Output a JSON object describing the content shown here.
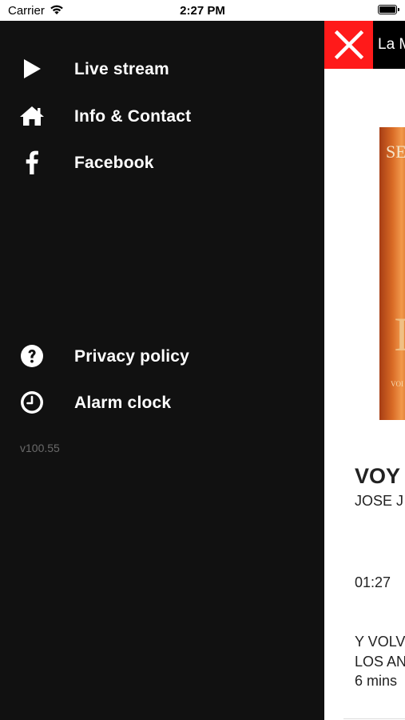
{
  "status_bar": {
    "carrier": "Carrier",
    "time": "2:27 PM"
  },
  "drawer": {
    "background": "#111111",
    "items": [
      {
        "label": "Live stream",
        "icon": "play-icon"
      },
      {
        "label": "Info & Contact",
        "icon": "home-icon"
      },
      {
        "label": "Facebook",
        "icon": "facebook-icon"
      },
      {
        "label": "Privacy policy",
        "icon": "question-circle-icon"
      },
      {
        "label": "Alarm clock",
        "icon": "clock-icon"
      }
    ],
    "version": "v100.55"
  },
  "player": {
    "close_color": "#ff1a1a",
    "station_title": "La M",
    "album_text": "SE",
    "album_letter": "I",
    "album_small": "VOI",
    "song_title": "VOY",
    "artist": "JOSE J",
    "elapsed": "01:27",
    "previous": {
      "line1": "Y VOLV",
      "line2": "LOS AN",
      "line3": "6 mins"
    }
  }
}
